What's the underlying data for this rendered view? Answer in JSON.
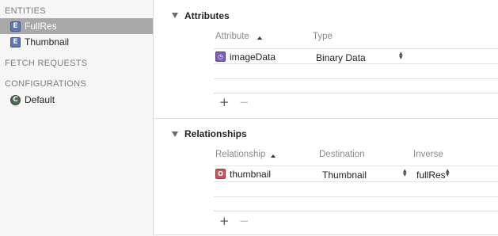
{
  "sidebar": {
    "entities_header": "ENTITIES",
    "entities": [
      {
        "label": "FullRes",
        "badge": "E",
        "selected": true
      },
      {
        "label": "Thumbnail",
        "badge": "E",
        "selected": false
      }
    ],
    "fetch_requests_header": "FETCH REQUESTS",
    "configurations_header": "CONFIGURATIONS",
    "configurations": [
      {
        "label": "Default",
        "badge": "C"
      }
    ]
  },
  "attributes": {
    "title": "Attributes",
    "columns": {
      "attribute": "Attribute",
      "type": "Type"
    },
    "rows": [
      {
        "name": "imageData",
        "type": "Binary Data"
      }
    ],
    "add": "+",
    "remove": "−"
  },
  "relationships": {
    "title": "Relationships",
    "columns": {
      "relationship": "Relationship",
      "destination": "Destination",
      "inverse": "Inverse"
    },
    "rows": [
      {
        "name": "thumbnail",
        "destination": "Thumbnail",
        "inverse": "fullRes"
      }
    ],
    "add": "+",
    "remove": "−"
  },
  "icons": {
    "attribute_badge": "◷",
    "relationship_badge": "O",
    "stepper_up": "▴",
    "stepper_down": "▾"
  },
  "colors": {
    "selected_row": "#a8a8a8",
    "entity_badge": "#5d76b8",
    "attribute_badge": "#7b5db4",
    "relationship_badge": "#c8555e"
  }
}
